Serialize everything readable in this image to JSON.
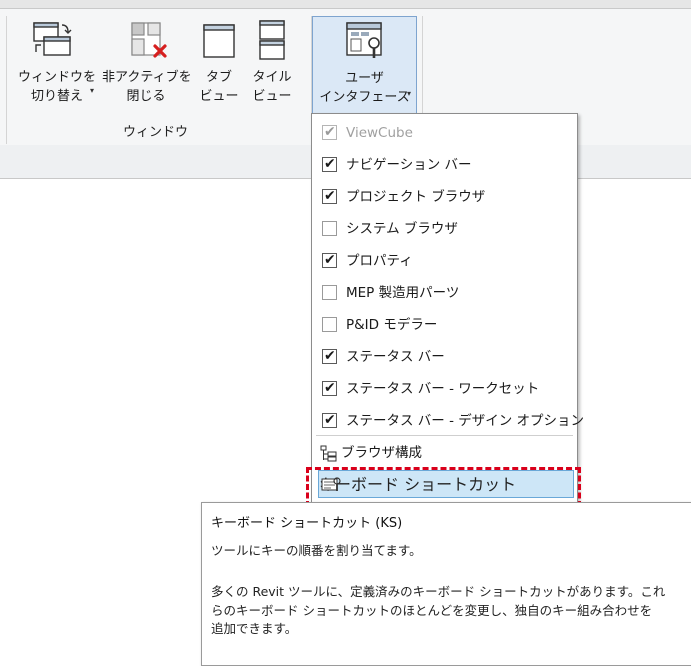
{
  "ribbon": {
    "buttons": [
      {
        "line1": "ウィンドウを",
        "line2": "切り替え",
        "icon": "switch-windows-icon",
        "has_dropdown": true
      },
      {
        "line1": "非アクティブを",
        "line2": "閉じる",
        "icon": "close-inactive-icon",
        "has_dropdown": false
      },
      {
        "line1": "タブ",
        "line2": "ビュー",
        "icon": "tab-views-icon",
        "has_dropdown": false
      },
      {
        "line1": "タイル",
        "line2": "ビュー",
        "icon": "tile-views-icon",
        "has_dropdown": false
      },
      {
        "line1": "ユーザ",
        "line2": "インタフェース",
        "icon": "user-interface-icon",
        "has_dropdown": true
      }
    ],
    "panel_label": "ウィンドウ",
    "dropdown_glyph": "▾"
  },
  "menu": {
    "items": [
      {
        "label": "ViewCube",
        "checked": true,
        "disabled": true
      },
      {
        "label": "ナビゲーション バー",
        "checked": true,
        "disabled": false
      },
      {
        "label": "プロジェクト ブラウザ",
        "checked": true,
        "disabled": false
      },
      {
        "label": "システム ブラウザ",
        "checked": false,
        "disabled": false
      },
      {
        "label": "プロパティ",
        "checked": true,
        "disabled": false
      },
      {
        "label": "MEP 製造用パーツ",
        "checked": false,
        "disabled": false
      },
      {
        "label": "P&ID モデラー",
        "checked": false,
        "disabled": false
      },
      {
        "label": "ステータス バー",
        "checked": true,
        "disabled": false
      },
      {
        "label": "ステータス バー - ワークセット",
        "checked": true,
        "disabled": false
      },
      {
        "label": "ステータス バー - デザイン オプション",
        "checked": true,
        "disabled": false
      }
    ],
    "browser_organization": {
      "label": "ブラウザ構成",
      "icon": "browser-organization-icon"
    },
    "keyboard_shortcuts": {
      "label": "キーボード ショートカット",
      "icon": "keyboard-shortcuts-icon"
    },
    "check_glyph": "✔"
  },
  "tooltip": {
    "title": "キーボード ショートカット (KS)",
    "summary": "ツールにキーの順番を割り当てます。",
    "description_lines": [
      "多くの Revit ツールに、定義済みのキーボード ショートカットがあります。これ",
      "らのキーボード ショートカットのほとんどを変更し、独自のキー組み合わせを",
      "追加できます。"
    ]
  },
  "colors": {
    "highlight_border": "#d9001b",
    "menu_hover_bg": "#cde6f7"
  }
}
